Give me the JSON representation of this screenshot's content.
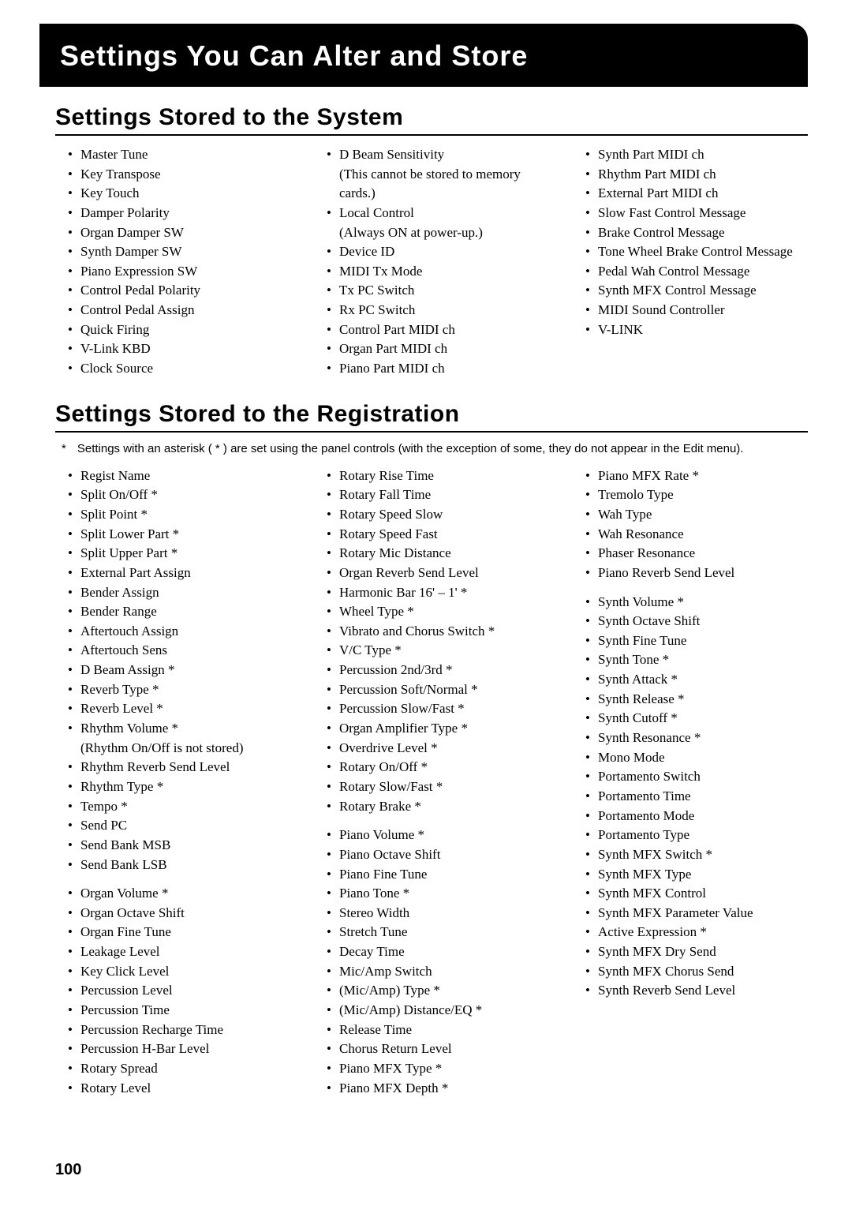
{
  "page_title": "Settings You Can Alter and Store",
  "section1": {
    "title": "Settings Stored to the System",
    "col1": [
      "Master Tune",
      "Key Transpose",
      "Key Touch",
      "Damper Polarity",
      "Organ Damper SW",
      "Synth Damper SW",
      "Piano Expression SW",
      "Control Pedal Polarity",
      "Control Pedal Assign",
      "Quick Firing",
      "V-Link KBD",
      "Clock Source"
    ],
    "col2": [
      {
        "t": "D Beam Sensitivity",
        "sub": "(This cannot be stored to memory cards.)"
      },
      {
        "t": "Local Control",
        "sub": "(Always ON at power-up.)"
      },
      {
        "t": "Device ID"
      },
      {
        "t": "MIDI Tx Mode"
      },
      {
        "t": "Tx PC Switch"
      },
      {
        "t": "Rx PC Switch"
      },
      {
        "t": "Control Part MIDI ch"
      },
      {
        "t": "Organ Part MIDI ch"
      },
      {
        "t": "Piano Part MIDI ch"
      }
    ],
    "col3": [
      "Synth Part MIDI ch",
      "Rhythm Part MIDI ch",
      "External Part MIDI ch",
      "Slow Fast Control Message",
      "Brake Control Message",
      "Tone Wheel Brake Control Message",
      "Pedal Wah Control Message",
      "Synth MFX Control Message",
      "MIDI Sound Controller",
      "V-LINK"
    ]
  },
  "section2": {
    "title": "Settings Stored to the Registration",
    "footnote": "Settings with an asterisk ( * ) are set using the panel controls (with the exception of some, they do not appear in the Edit menu).",
    "col1": [
      "Regist Name",
      "Split On/Off *",
      "Split Point *",
      "Split Lower Part *",
      "Split Upper Part *",
      "External Part Assign",
      "Bender Assign",
      "Bender Range",
      "Aftertouch Assign",
      "Aftertouch Sens",
      "D Beam Assign *",
      "Reverb Type *",
      "Reverb Level *",
      {
        "t": "Rhythm Volume *",
        "sub": "(Rhythm On/Off is not stored)"
      },
      "Rhythm Reverb Send Level",
      "Rhythm Type *",
      "Tempo *",
      "Send PC",
      "Send Bank MSB",
      "Send Bank LSB",
      "SPACER",
      "Organ Volume *",
      "Organ Octave Shift",
      "Organ Fine Tune",
      "Leakage Level",
      "Key Click Level",
      "Percussion Level",
      "Percussion Time",
      "Percussion Recharge Time",
      "Percussion H-Bar Level",
      "Rotary Spread",
      "Rotary Level"
    ],
    "col2": [
      "Rotary Rise Time",
      "Rotary Fall Time",
      "Rotary Speed Slow",
      "Rotary Speed Fast",
      "Rotary Mic Distance",
      "Organ Reverb Send Level",
      "Harmonic Bar 16' – 1' *",
      "Wheel Type *",
      "Vibrato and Chorus Switch *",
      "V/C Type *",
      "Percussion 2nd/3rd *",
      "Percussion Soft/Normal *",
      "Percussion Slow/Fast *",
      "Organ Amplifier Type *",
      "Overdrive Level *",
      "Rotary On/Off *",
      "Rotary Slow/Fast *",
      "Rotary Brake *",
      "SPACER",
      "Piano Volume *",
      "Piano Octave Shift",
      "Piano Fine Tune",
      "Piano Tone *",
      "Stereo Width",
      "Stretch Tune",
      "Decay Time",
      "Mic/Amp Switch",
      "(Mic/Amp) Type *",
      "(Mic/Amp) Distance/EQ *",
      "Release Time",
      "Chorus Return Level",
      "Piano MFX Type *",
      "Piano MFX Depth *"
    ],
    "col3": [
      "Piano MFX Rate *",
      "Tremolo Type",
      "Wah Type",
      "Wah Resonance",
      "Phaser Resonance",
      "Piano Reverb Send Level",
      "SPACER",
      "Synth Volume *",
      "Synth Octave Shift",
      "Synth Fine Tune",
      "Synth Tone *",
      "Synth Attack *",
      "Synth Release *",
      "Synth Cutoff *",
      "Synth Resonance *",
      "Mono Mode",
      "Portamento Switch",
      "Portamento Time",
      "Portamento Mode",
      "Portamento Type",
      "Synth MFX Switch *",
      "Synth MFX Type",
      "Synth MFX Control",
      "Synth MFX Parameter Value",
      "Active Expression *",
      "Synth MFX Dry Send",
      "Synth MFX Chorus Send",
      "Synth Reverb Send Level"
    ]
  },
  "page_number": "100"
}
